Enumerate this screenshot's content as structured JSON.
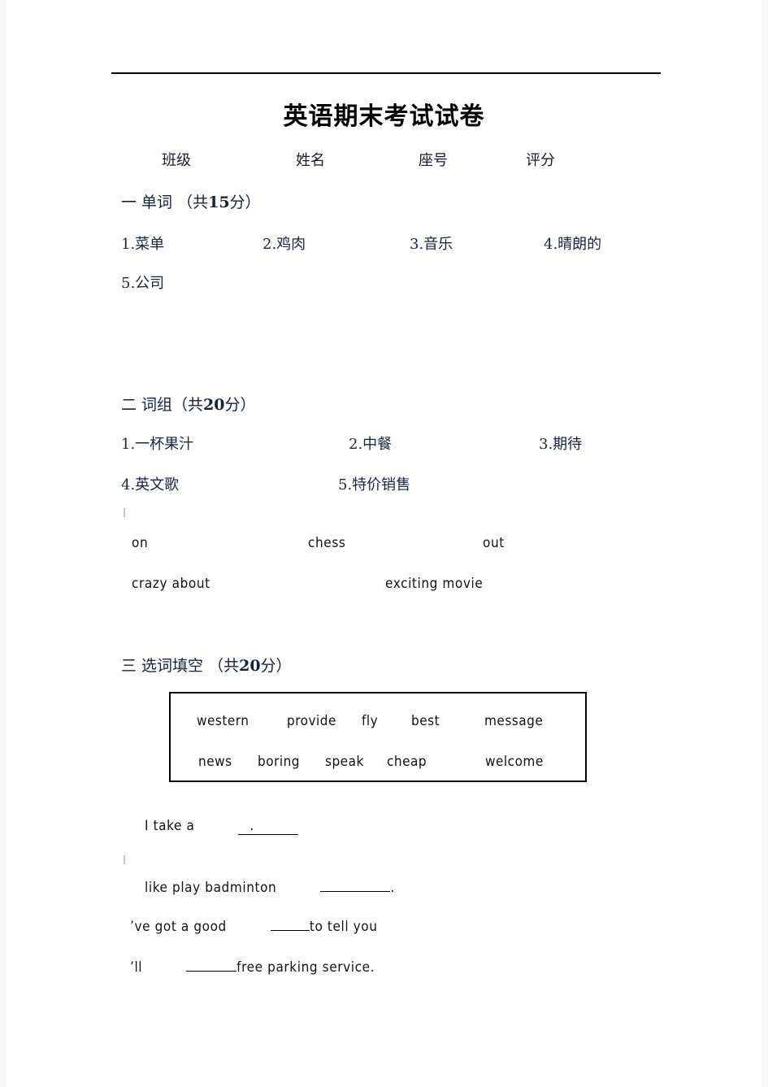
{
  "document": {
    "title": "英语期末考试试卷",
    "meta_fields": [
      "班级",
      "姓名",
      "座号",
      "评分"
    ]
  },
  "sections": {
    "one": {
      "heading_label": "一  单词  （共",
      "points": "15",
      "heading_suffix": "分）",
      "row1": [
        "1.菜单",
        "2.鸡肉",
        "3.音乐",
        "4.晴朗的"
      ],
      "row2": [
        "5.公司"
      ]
    },
    "two": {
      "heading_label": "二  词组（共",
      "points": "20",
      "heading_suffix": "分）",
      "row1": [
        "1.一杯果汁",
        "2.中餐",
        "3.期待"
      ],
      "row2": [
        "4.英文歌",
        "5.特价销售"
      ],
      "english_row1": [
        "on",
        "chess",
        "out"
      ],
      "english_row2": [
        "crazy about",
        "exciting movie"
      ]
    },
    "three": {
      "heading_label": "三  选词填空  （共",
      "points": "20",
      "heading_suffix": "分）",
      "word_bank_row1": [
        "western",
        "provide",
        "fly",
        "best",
        "message"
      ],
      "word_bank_row2": [
        "news",
        "boring",
        "speak",
        "cheap",
        "welcome"
      ],
      "questions": {
        "q1_before": "I take a",
        "q1_dot": ".",
        "q2_before": "like play badminton",
        "q2_after": ".",
        "q3_before": "’ve got a good",
        "q3_after": "to tell you",
        "q4_before": "’ll",
        "q4_after": "free parking service."
      }
    }
  }
}
